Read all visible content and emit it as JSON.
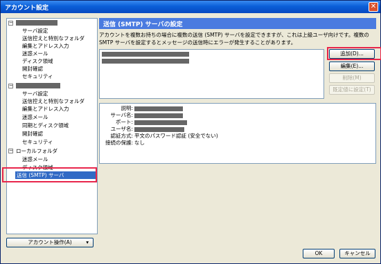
{
  "window": {
    "title": "アカウント設定",
    "close_glyph": "✕"
  },
  "tree": {
    "group1": {
      "items": [
        "サーバ設定",
        "送信控えと特別なフォルダ",
        "編集とアドレス入力",
        "迷惑メール",
        "ディスク領域",
        "開封確認",
        "セキュリティ"
      ]
    },
    "group2": {
      "items": [
        "サーバ設定",
        "送信控えと特別なフォルダ",
        "編集とアドレス入力",
        "迷惑メール",
        "同期とディスク領域",
        "開封確認",
        "セキュリティ"
      ]
    },
    "local": {
      "label": "ローカルフォルダ",
      "items": [
        "迷惑メール",
        "ディスク領域"
      ]
    },
    "smtp": {
      "label": "送信 (SMTP) サーバ"
    },
    "expander": "−"
  },
  "account_actions": {
    "label": "アカウント操作(A)",
    "arrow": "▾"
  },
  "panel": {
    "title": "送信 (SMTP) サーバの設定",
    "description": "アカウントを複数お持ちの場合に複数の送信 (SMTP) サーバを設定できますが、これは上級ユーザ向けです。複数の SMTP サーバを設定するとメッセージの送信時にエラーが発生することがあります。"
  },
  "buttons": {
    "add": "追加(D)...",
    "edit": "編集(E)...",
    "delete": "削除(M)",
    "set_default": "既定値に設定(T)"
  },
  "details": {
    "labels": {
      "description": "説明:",
      "server": "サーバ名:",
      "port": "ポート:",
      "user": "ユーザ名:",
      "auth": "認証方式:",
      "security": "接続の保護:"
    },
    "auth_value": "平文のパスワード認証 (安全でない)",
    "security_value": "なし"
  },
  "dialog": {
    "ok": "OK",
    "cancel": "キャンセル"
  },
  "colors": {
    "highlight": "#e8254a",
    "selection": "#316ac5",
    "header": "#4a7be0"
  }
}
